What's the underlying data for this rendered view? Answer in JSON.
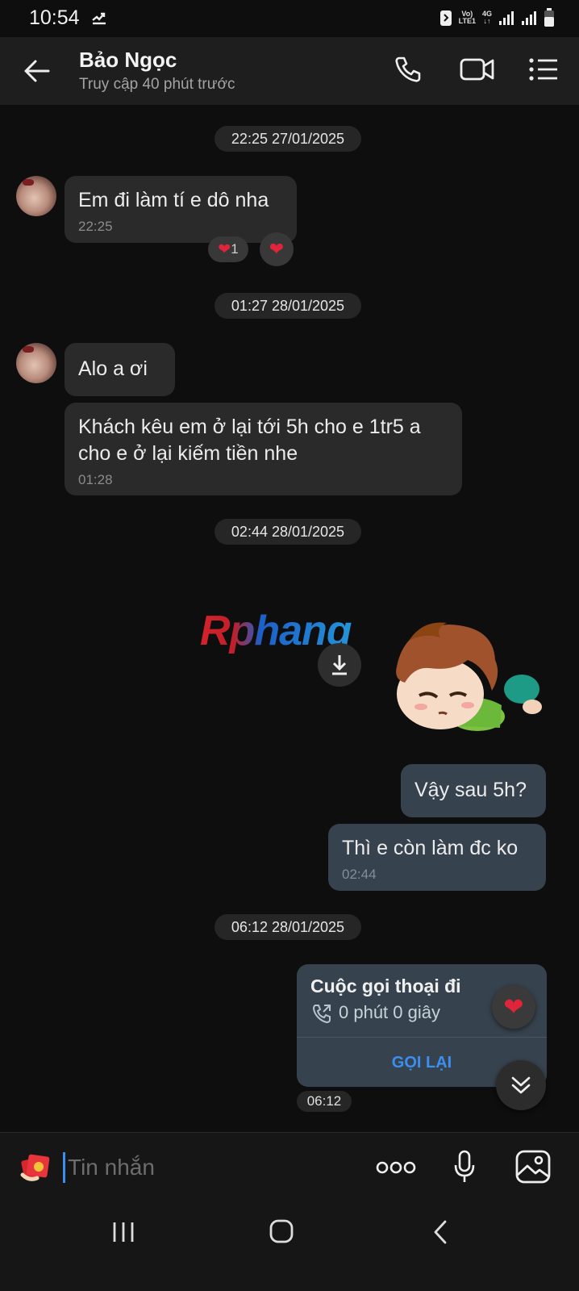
{
  "status_bar": {
    "time": "10:54",
    "network_top": "Vo)",
    "network_bottom": "LTE1",
    "network_type": "4G"
  },
  "header": {
    "contact_name": "Bảo Ngọc",
    "contact_status": "Truy cập 40 phút trước",
    "icons": [
      "back-arrow",
      "phone",
      "video-camera",
      "list-menu"
    ]
  },
  "messages": {
    "date1": "22:25 27/01/2025",
    "m1_text": "Em đi làm tí e dô nha",
    "m1_time": "22:25",
    "m1_reaction_count": "1",
    "date2": "01:27 28/01/2025",
    "m2_text": "Alo a ơi",
    "m3_text": "Khách kêu em ở lại tới 5h cho e 1tr5 a cho e ở lại kiếm tiền nhe",
    "m3_time": "01:28",
    "date3": "02:44 28/01/2025",
    "watermark": "Rphang",
    "m4_text": "Vậy sau 5h?",
    "m5_text": "Thì e còn làm đc ko",
    "m5_time": "02:44",
    "date4": "06:12 28/01/2025",
    "call_title": "Cuộc gọi thoại đi",
    "call_duration": "0 phút 0 giây",
    "call_again": "GỌI LẠI",
    "call_time": "06:12"
  },
  "input_bar": {
    "placeholder": "Tin nhắn"
  },
  "colors": {
    "background": "#0e0e0e",
    "header": "#1e1e1e",
    "incoming_bubble": "#2a2a2a",
    "outgoing_bubble": "#36424d",
    "accent": "#3b8ff0",
    "heart": "#e0243a"
  }
}
